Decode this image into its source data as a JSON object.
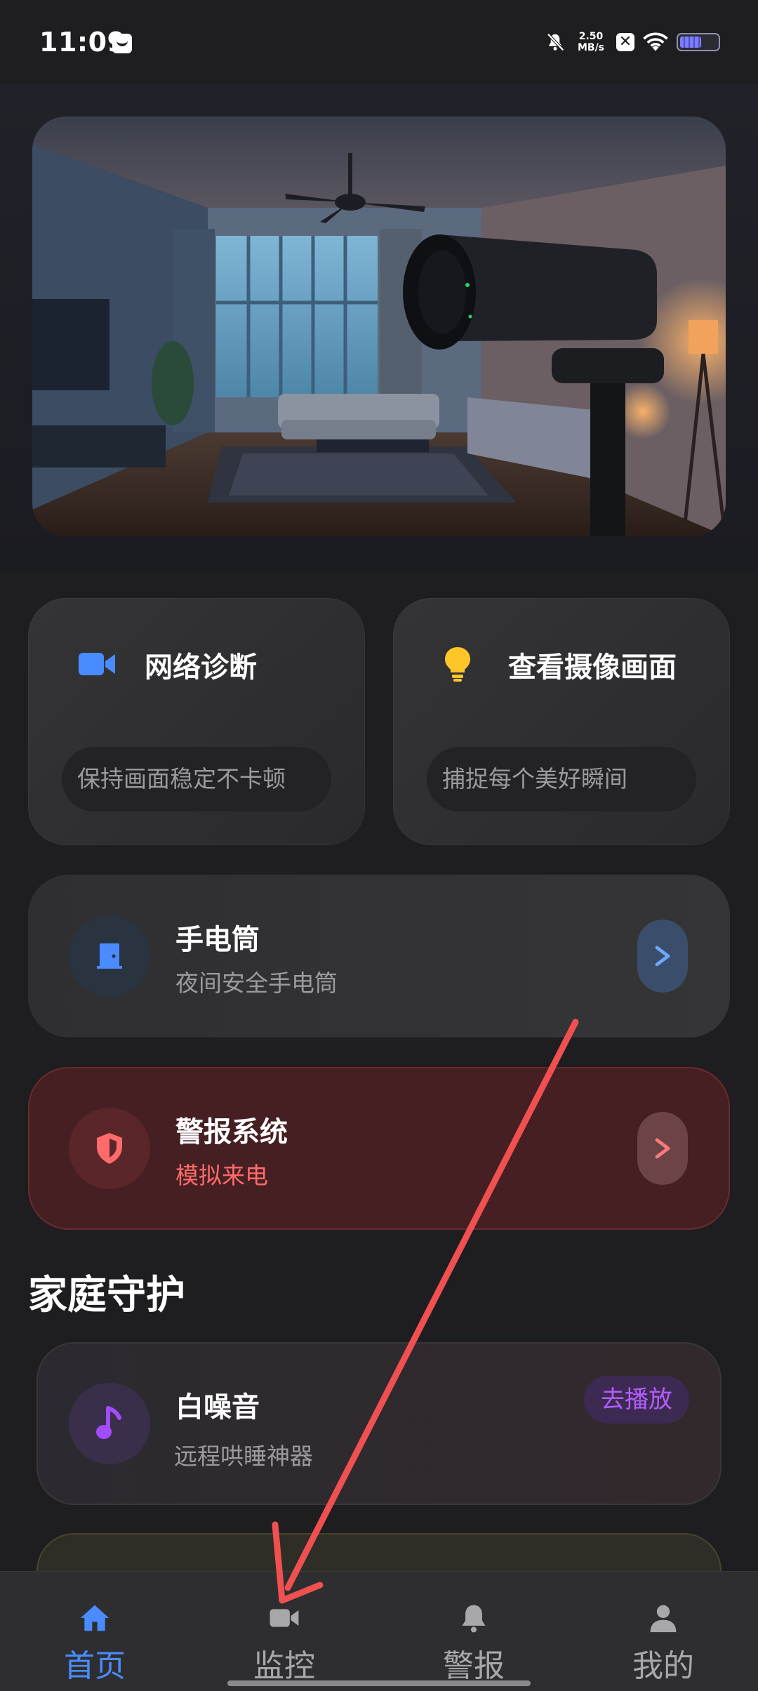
{
  "status_bar": {
    "time": "11:09",
    "net_speed_value": "2.50",
    "net_speed_unit": "MB/s",
    "x_label": "✕"
  },
  "hero": {
    "image": "living-room-security-camera"
  },
  "quick_cards": [
    {
      "title": "网络诊断",
      "subtitle": "保持画面稳定不卡顿",
      "icon": "video-camera-icon",
      "color": "#4a8cff"
    },
    {
      "title": "查看摄像画面",
      "subtitle": "捕捉每个美好瞬间",
      "icon": "lightbulb-icon",
      "color": "#ffc629"
    }
  ],
  "flashlight": {
    "title": "手电筒",
    "subtitle": "夜间安全手电筒",
    "icon": "door-icon",
    "accent": "#4a8cff"
  },
  "alarm": {
    "title": "警报系统",
    "subtitle": "模拟来电",
    "icon": "shield-icon",
    "accent": "#ff5a5a",
    "subtitle_color": "#ff6b6b"
  },
  "section": {
    "title": "家庭守护"
  },
  "white_noise": {
    "title": "白噪音",
    "subtitle": "远程哄睡神器",
    "action": "去播放",
    "icon": "music-note-icon",
    "accent": "#a24bff"
  },
  "bottom_nav": {
    "items": [
      {
        "label": "首页",
        "icon": "home-icon",
        "active": true
      },
      {
        "label": "监控",
        "icon": "video-camera-icon",
        "active": false
      },
      {
        "label": "警报",
        "icon": "bell-icon",
        "active": false
      },
      {
        "label": "我的",
        "icon": "person-icon",
        "active": false
      }
    ],
    "active_color": "#4a8cff",
    "inactive_color": "#a8a8ac"
  }
}
